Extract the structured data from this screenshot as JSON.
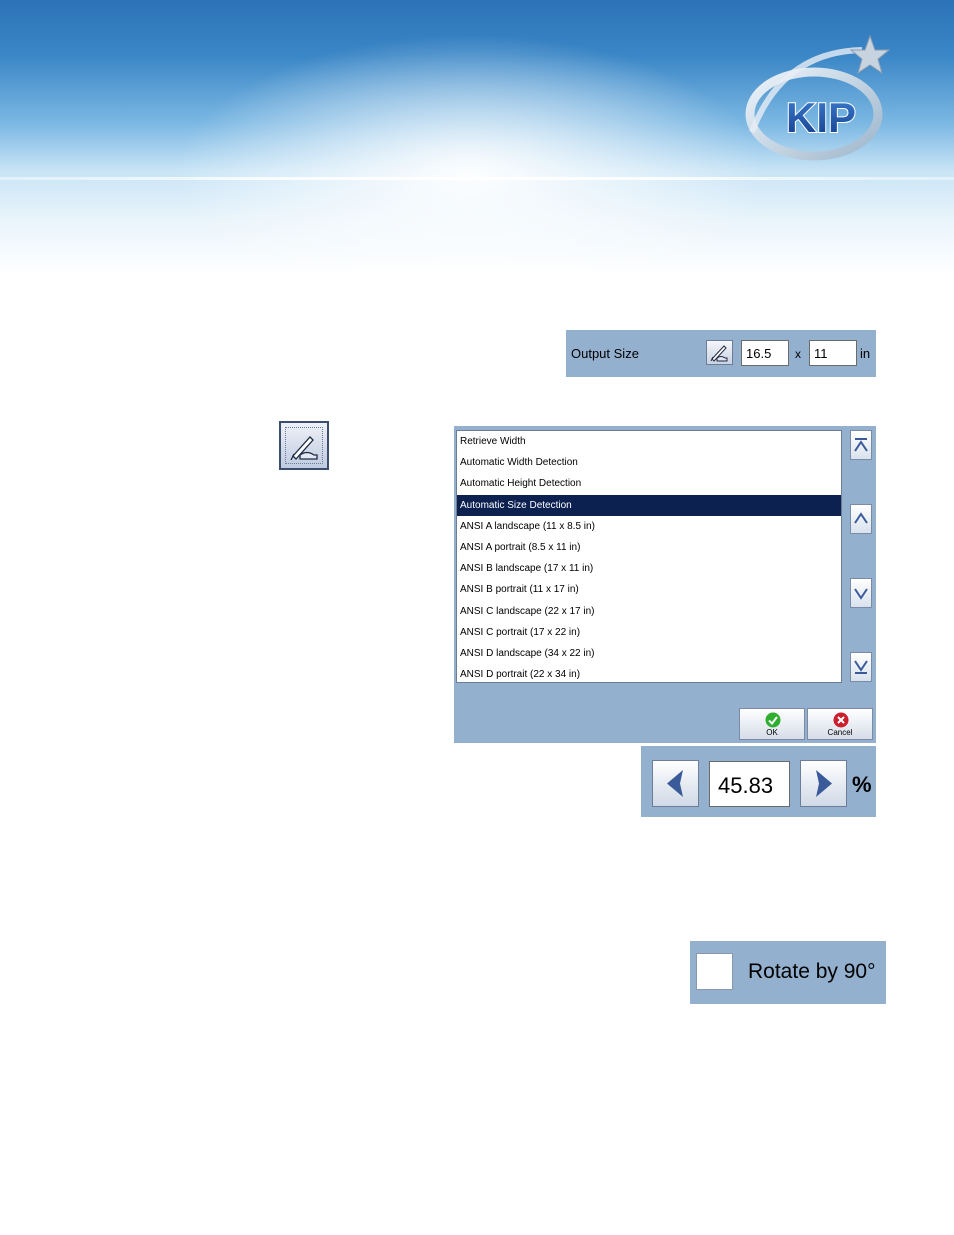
{
  "logo": {
    "text": "KIP"
  },
  "output_size": {
    "label": "Output Size",
    "width_value": "16.5",
    "separator": "x",
    "height_value": "11",
    "unit": "in"
  },
  "size_list": {
    "items": [
      "Retrieve Width",
      "Automatic Width Detection",
      "Automatic Height Detection",
      "Automatic Size Detection",
      "ANSI A landscape (11 x 8.5 in)",
      "ANSI A portrait (8.5 x 11 in)",
      "ANSI B landscape (17 x 11 in)",
      "ANSI B portrait (11 x 17 in)",
      "ANSI C landscape (22 x 17 in)",
      "ANSI C portrait (17 x 22 in)",
      "ANSI D landscape (34 x 22 in)",
      "ANSI D portrait (22 x 34 in)"
    ],
    "selected_index": 3,
    "ok_label": "OK",
    "cancel_label": "Cancel"
  },
  "scale": {
    "value": "45.83",
    "unit": "%"
  },
  "rotate": {
    "label": "Rotate by 90°",
    "checked": false
  },
  "colors": {
    "panel": "#94b0cf",
    "selection": "#0c2150",
    "arrow": "#3b5a9a",
    "ok_green": "#2fae2f",
    "cancel_red": "#cc1f2d"
  },
  "icons": [
    "pen-edit-icon",
    "scroll-top-icon",
    "scroll-up-icon",
    "scroll-down-icon",
    "scroll-bottom-icon",
    "checkmark-icon",
    "x-circle-icon",
    "arrow-left-icon",
    "arrow-right-icon"
  ]
}
